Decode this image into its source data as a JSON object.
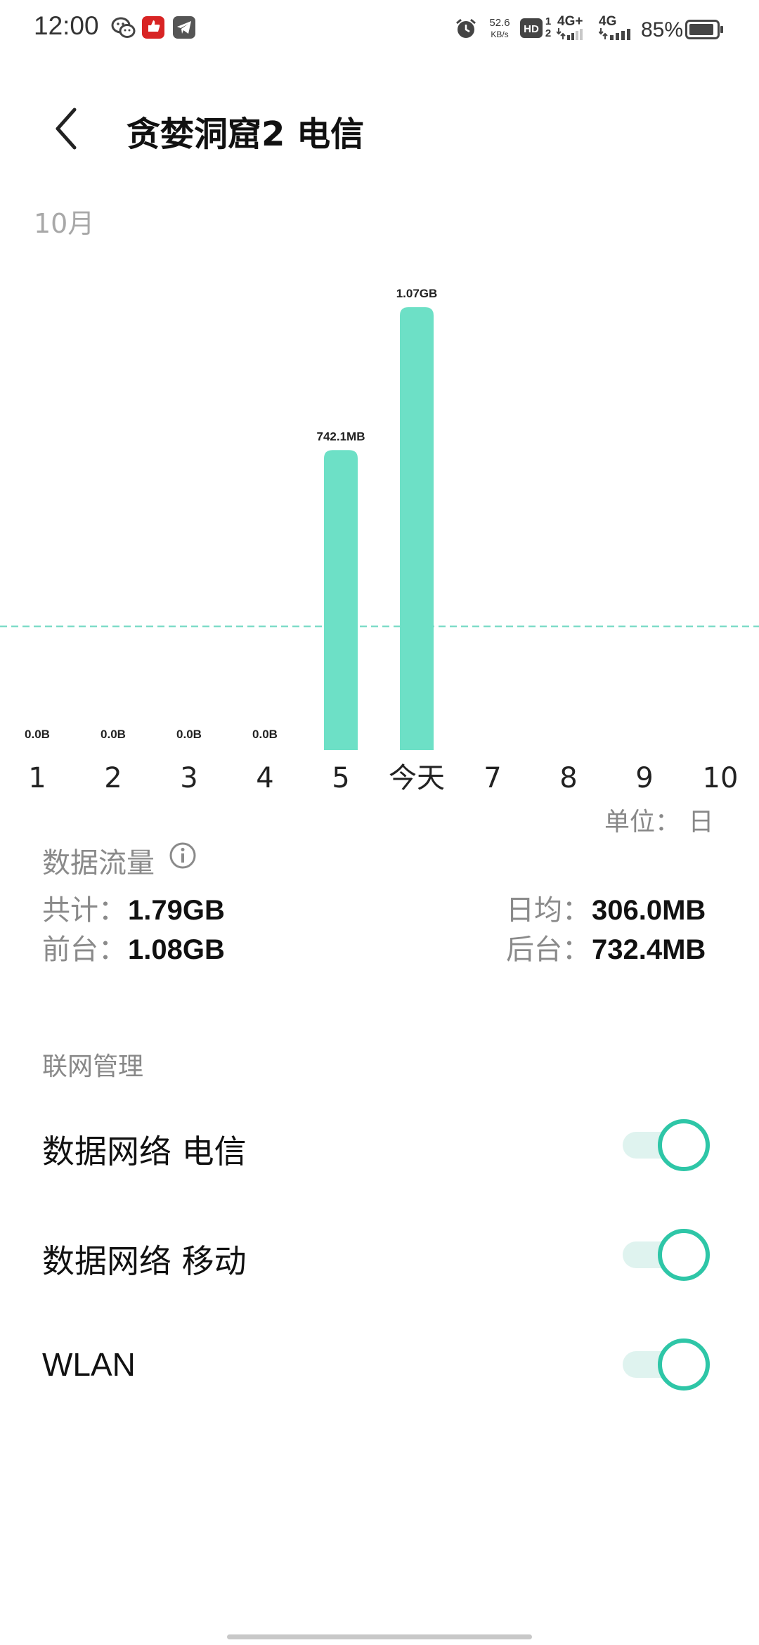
{
  "status_bar": {
    "time": "12:00",
    "speed_value": "52.6",
    "speed_unit": "KB/s",
    "hd_label": "HD",
    "sim1": "1",
    "sim2": "2",
    "network1": "4G+",
    "network2": "4G",
    "battery_percent": "85%",
    "icons": [
      "wechat-icon",
      "app-icon",
      "telegram-icon",
      "alarm-icon",
      "hd-icon",
      "signal-icon",
      "battery-icon"
    ]
  },
  "header": {
    "back": "back-icon",
    "title": "贪婪洞窟2 电信"
  },
  "month": "10月",
  "chart_data": {
    "type": "bar",
    "categories": [
      "1",
      "2",
      "3",
      "4",
      "5",
      "今天",
      "7",
      "8",
      "9",
      "10"
    ],
    "values_mb": [
      0,
      0,
      0,
      0,
      742.1,
      1095.7,
      null,
      null,
      null,
      null
    ],
    "value_labels": [
      "0.0B",
      "0.0B",
      "0.0B",
      "0.0B",
      "742.1MB",
      "1.07GB",
      "",
      "",
      "",
      ""
    ],
    "average_line_mb": 306.0,
    "bar_color": "#6de0c6",
    "average_line_color": "#7fdcc8"
  },
  "unit": "单位： 日",
  "data_usage": {
    "title": "数据流量",
    "total_label": "共计：",
    "total_value": "1.79GB",
    "avg_label": "日均：",
    "avg_value": "306.0MB",
    "fg_label": "前台：",
    "fg_value": "1.08GB",
    "bg_label": "后台：",
    "bg_value": "732.4MB"
  },
  "network_management": {
    "title": "联网管理",
    "items": [
      {
        "label": "数据网络 电信",
        "enabled": true
      },
      {
        "label": "数据网络 移动",
        "enabled": true
      },
      {
        "label": "WLAN",
        "enabled": true
      }
    ]
  },
  "colors": {
    "accent": "#2ec6a7",
    "track": "#dff3ef"
  }
}
